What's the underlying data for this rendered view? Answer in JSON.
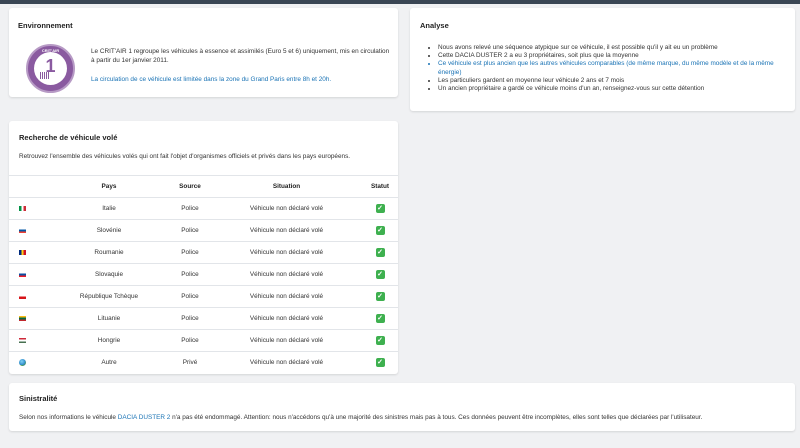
{
  "environnement": {
    "title": "Environnement",
    "badge_label": "CRIT'AIR",
    "badge_number": "1",
    "badge_sub": "LA TRÈS BELLE",
    "description": "Le CRIT'AIR 1 regroupe les véhicules à essence et assimilés (Euro 5 et 6) uniquement, mis en circulation à partir du 1er janvier 2011.",
    "warning": "La circulation de ce véhicule est limitée dans la zone du Grand Paris entre 8h et 20h.",
    "badge_color": "#8a5aa0"
  },
  "analyse": {
    "title": "Analyse",
    "items": [
      {
        "text": "Nous avons relevé une séquence atypique sur ce véhicule, il est possible qu'il y ait eu un problème",
        "highlight": false
      },
      {
        "text": "Cette DACIA DUSTER 2 a eu 3 propriétaires, soit plus que la moyenne",
        "highlight": false
      },
      {
        "text": "Ce véhicule est plus ancien que les autres véhicules comparables (de même marque, du même modèle et de la même énergie)",
        "highlight": true
      },
      {
        "text": "Les particuliers gardent en moyenne leur véhicule 2 ans et 7 mois",
        "highlight": false
      },
      {
        "text": "Un ancien propriétaire a gardé ce véhicule moins d'un an, renseignez-vous sur cette détention",
        "highlight": false
      }
    ]
  },
  "vol": {
    "title": "Recherche de véhicule volé",
    "subtitle": "Retrouvez l'ensemble des véhicules volés qui ont fait l'objet d'organismes officiels et privés dans les pays européens.",
    "columns": {
      "pays": "Pays",
      "source": "Source",
      "situation": "Situation",
      "statut": "Statut"
    },
    "rows": [
      {
        "flag": "IT",
        "pays": "Italie",
        "source": "Police",
        "situation": "Véhicule non déclaré volé",
        "statut": "✓"
      },
      {
        "flag": "SI",
        "pays": "Slovénie",
        "source": "Police",
        "situation": "Véhicule non déclaré volé",
        "statut": "✓"
      },
      {
        "flag": "RO",
        "pays": "Roumanie",
        "source": "Police",
        "situation": "Véhicule non déclaré volé",
        "statut": "✓"
      },
      {
        "flag": "SK",
        "pays": "Slovaquie",
        "source": "Police",
        "situation": "Véhicule non déclaré volé",
        "statut": "✓"
      },
      {
        "flag": "CZ",
        "pays": "République Tchèque",
        "source": "Police",
        "situation": "Véhicule non déclaré volé",
        "statut": "✓"
      },
      {
        "flag": "LT",
        "pays": "Lituanie",
        "source": "Police",
        "situation": "Véhicule non déclaré volé",
        "statut": "✓"
      },
      {
        "flag": "HU",
        "pays": "Hongrie",
        "source": "Police",
        "situation": "Véhicule non déclaré volé",
        "statut": "✓"
      },
      {
        "flag": "globe",
        "pays": "Autre",
        "source": "Privé",
        "situation": "Véhicule non déclaré volé",
        "statut": "✓"
      }
    ]
  },
  "sinistralite": {
    "title": "Sinistralité",
    "text_before": "Selon nos informations le véhicule ",
    "vehicle": "DACIA DUSTER 2",
    "text_after": " n'a pas été endommagé. Attention: nous n'accédons qu'à une majorité des sinistres mais pas à tous. Ces données peuvent être incomplètes, elles sont telles que déclarées par l'utilisateur."
  },
  "colors": {
    "link": "#1a73b5",
    "check": "#3eb04f",
    "topbar": "#3a4654"
  }
}
